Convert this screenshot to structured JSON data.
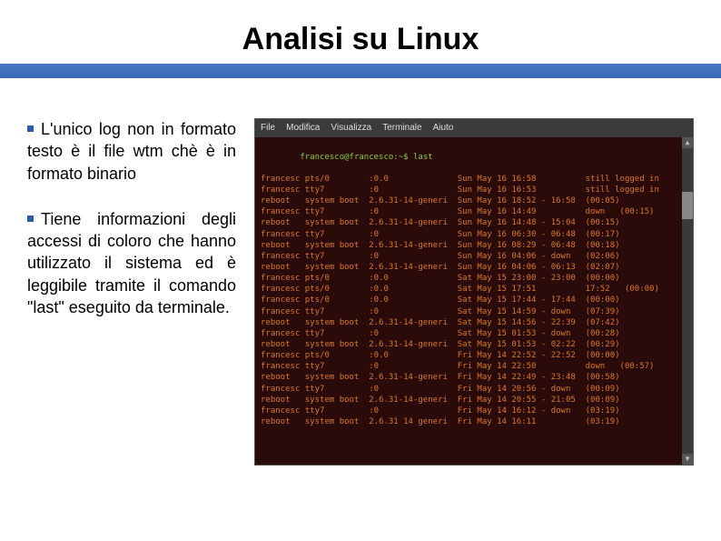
{
  "slide": {
    "title": "Analisi su Linux",
    "paragraphs": [
      "L'unico log non in formato testo è il file wtm chè è in formato binario",
      "Tiene informazioni degli accessi di coloro che hanno utilizzato il sistema ed è leggibile tramite il comando \"last\" eseguito da terminale."
    ]
  },
  "terminal": {
    "menu": [
      "File",
      "Modifica",
      "Visualizza",
      "Terminale",
      "Aiuto"
    ],
    "prompt": "francesco@francesco:~$ last",
    "rows": [
      {
        "user": "francesc",
        "tty": "pts/0",
        "from": ":0.0",
        "date": "Sun May 16 16:58",
        "status": "still logged in"
      },
      {
        "user": "francesc",
        "tty": "tty7",
        "from": ":0",
        "date": "Sun May 16 16:53",
        "status": "still logged in"
      },
      {
        "user": "reboot",
        "tty": "system boot",
        "from": "2.6.31-14-generi",
        "date": "Sun May 16 18:52 - 16:58",
        "status": "(00:05)"
      },
      {
        "user": "francesc",
        "tty": "tty7",
        "from": ":0",
        "date": "Sun May 16 14:49",
        "status": "down   (00:15)"
      },
      {
        "user": "reboot",
        "tty": "system boot",
        "from": "2.6.31-14-generi",
        "date": "Sun May 16 14:48 - 15:04",
        "status": "(00:15)"
      },
      {
        "user": "francesc",
        "tty": "tty7",
        "from": ":0",
        "date": "Sun May 16 06:30 - 06:48",
        "status": "(00:17)"
      },
      {
        "user": "reboot",
        "tty": "system boot",
        "from": "2.6.31-14-generi",
        "date": "Sun May 16 08:29 - 06:48",
        "status": "(00:18)"
      },
      {
        "user": "francesc",
        "tty": "tty7",
        "from": ":0",
        "date": "Sun May 16 04:06 - down",
        "status": "(02:06)"
      },
      {
        "user": "reboot",
        "tty": "system boot",
        "from": "2.6.31-14-generi",
        "date": "Sun May 16 04:06 - 06:13",
        "status": "(02:07)"
      },
      {
        "user": "francesc",
        "tty": "pts/0",
        "from": ":0.0",
        "date": "Sat May 15 23:00 - 23:00",
        "status": "(00:00)"
      },
      {
        "user": "francesc",
        "tty": "pts/0",
        "from": ":0.0",
        "date": "Sat May 15 17:51",
        "status": "17:52   (00:00)"
      },
      {
        "user": "francesc",
        "tty": "pts/0",
        "from": ":0.0",
        "date": "Sat May 15 17:44 - 17:44",
        "status": "(00:00)"
      },
      {
        "user": "francesc",
        "tty": "tty7",
        "from": ":0",
        "date": "Sat May 15 14:59 - down",
        "status": "(07:39)"
      },
      {
        "user": "reboot",
        "tty": "system boot",
        "from": "2.6.31-14-generi",
        "date": "Sat May 15 14:56 - 22:39",
        "status": "(07:42)"
      },
      {
        "user": "francesc",
        "tty": "tty7",
        "from": ":0",
        "date": "Sat May 15 01:53 - down",
        "status": "(00:28)"
      },
      {
        "user": "reboot",
        "tty": "system boot",
        "from": "2.6.31-14-generi",
        "date": "Sat May 15 01:53 - 02:22",
        "status": "(00:29)"
      },
      {
        "user": "francesc",
        "tty": "pts/0",
        "from": ":0.0",
        "date": "Fri May 14 22:52 - 22:52",
        "status": "(00:00)"
      },
      {
        "user": "francesc",
        "tty": "tty7",
        "from": ":0",
        "date": "Fri May 14 22:50",
        "status": "down   (00:57)"
      },
      {
        "user": "reboot",
        "tty": "system boot",
        "from": "2.6.31-14-generi",
        "date": "Fri May 14 22:49 - 23:48",
        "status": "(00:58)"
      },
      {
        "user": "francesc",
        "tty": "tty7",
        "from": ":0",
        "date": "Fri May 14 20:56 - down",
        "status": "(00:09)"
      },
      {
        "user": "reboot",
        "tty": "system boot",
        "from": "2.6.31-14-generi",
        "date": "Fri May 14 20:55 - 21:05",
        "status": "(00:09)"
      },
      {
        "user": "francesc",
        "tty": "tty7",
        "from": ":0",
        "date": "Fri May 14 16:12 - down",
        "status": "(03:19)"
      },
      {
        "user": "reboot",
        "tty": "system boot",
        "from": "2.6.31 14 generi",
        "date": "Fri May 14 16:11",
        "status": "(03:19)"
      }
    ]
  }
}
